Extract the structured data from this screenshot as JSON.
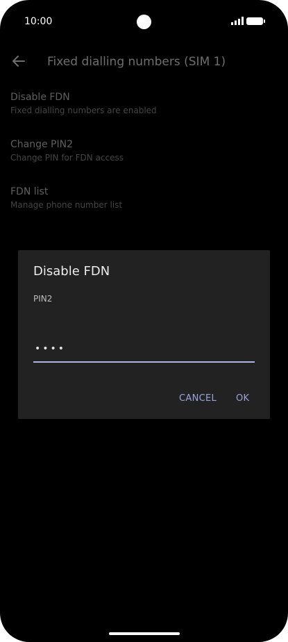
{
  "status_bar": {
    "time": "10:00",
    "camera_icon": "camera-icon",
    "signal_icon": "signal-icon",
    "battery_icon": "battery-icon"
  },
  "app_bar": {
    "back_icon": "arrow-left-icon",
    "title": "Fixed dialling numbers (SIM 1)"
  },
  "settings": [
    {
      "title": "Disable FDN",
      "subtitle": "Fixed dialling numbers are enabled"
    },
    {
      "title": "Change PIN2",
      "subtitle": "Change PIN for FDN access"
    },
    {
      "title": "FDN list",
      "subtitle": "Manage phone number list"
    }
  ],
  "dialog": {
    "title": "Disable FDN",
    "field_label": "PIN2",
    "pin_value": "••••",
    "cancel_label": "CANCEL",
    "ok_label": "OK"
  },
  "colors": {
    "accent": "#9aa4dc",
    "background": "#000000",
    "dialog_bg": "#222222"
  }
}
